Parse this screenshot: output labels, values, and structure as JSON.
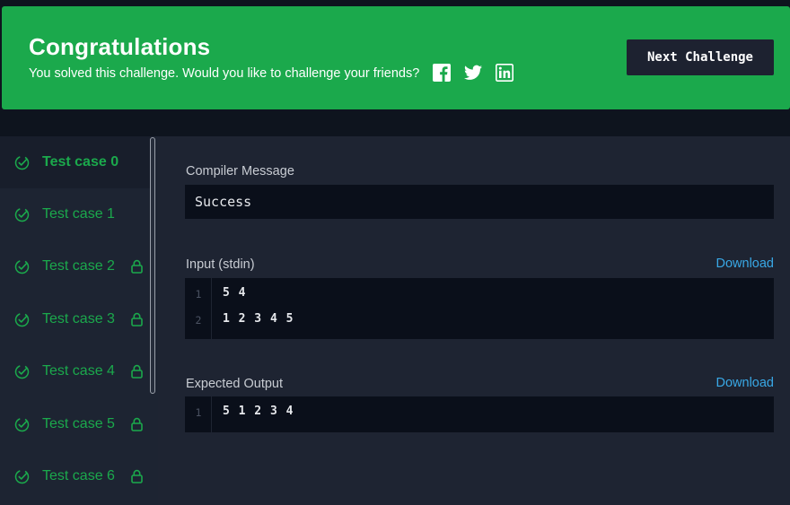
{
  "banner": {
    "title": "Congratulations",
    "subtitle": "You solved this challenge. Would you like to challenge your friends?",
    "social": [
      "facebook-icon",
      "twitter-icon",
      "linkedin-icon"
    ],
    "next_label": "Next Challenge",
    "color": "#1ba94c"
  },
  "test_cases": [
    {
      "label": "Test case 0",
      "passed": true,
      "locked": false,
      "active": true
    },
    {
      "label": "Test case 1",
      "passed": true,
      "locked": false,
      "active": false
    },
    {
      "label": "Test case 2",
      "passed": true,
      "locked": true,
      "active": false
    },
    {
      "label": "Test case 3",
      "passed": true,
      "locked": true,
      "active": false
    },
    {
      "label": "Test case 4",
      "passed": true,
      "locked": true,
      "active": false
    },
    {
      "label": "Test case 5",
      "passed": true,
      "locked": true,
      "active": false
    },
    {
      "label": "Test case 6",
      "passed": true,
      "locked": true,
      "active": false
    }
  ],
  "compiler": {
    "label": "Compiler Message",
    "value": "Success"
  },
  "input": {
    "label": "Input (stdin)",
    "download": "Download",
    "lines": [
      {
        "n": "1",
        "text": "5 4"
      },
      {
        "n": "2",
        "text": "1 2 3 4 5"
      }
    ]
  },
  "expected": {
    "label": "Expected Output",
    "download": "Download",
    "lines": [
      {
        "n": "1",
        "text": "5 1 2 3 4"
      }
    ]
  },
  "colors": {
    "success": "#1ba94c",
    "link": "#39a8e6",
    "panel": "#1e2432"
  }
}
